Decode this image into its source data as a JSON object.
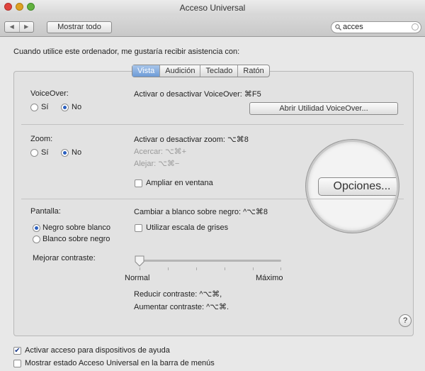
{
  "window": {
    "title": "Acceso Universal"
  },
  "toolbar": {
    "back_glyph": "◀",
    "forward_glyph": "▶",
    "show_all_label": "Mostrar todo",
    "search_value": "acces",
    "search_icon": "search-icon",
    "clear_icon": "clear-icon"
  },
  "main": {
    "intro": "Cuando utilice este ordenador, me gustaría recibir asistencia con:",
    "tabs": [
      {
        "label": "Vista",
        "selected": true
      },
      {
        "label": "Audición",
        "selected": false
      },
      {
        "label": "Teclado",
        "selected": false
      },
      {
        "label": "Ratón",
        "selected": false
      }
    ]
  },
  "voiceover": {
    "label": "VoiceOver:",
    "options": [
      {
        "label": "Sí",
        "selected": false
      },
      {
        "label": "No",
        "selected": true
      }
    ],
    "shortcut": "Activar o desactivar VoiceOver: ⌘F5",
    "open_utility_button": "Abrir Utilidad VoiceOver..."
  },
  "zoom": {
    "label": "Zoom:",
    "options": [
      {
        "label": "Sí",
        "selected": false
      },
      {
        "label": "No",
        "selected": true
      }
    ],
    "shortcut": "Activar o desactivar zoom: ⌥⌘8",
    "zoom_in": "Acercar: ⌥⌘+",
    "zoom_out": "Alejar: ⌥⌘−",
    "window_checkbox": {
      "label": "Ampliar en ventana",
      "checked": false
    },
    "options_button": "Opciones..."
  },
  "display": {
    "label": "Pantalla:",
    "options": [
      {
        "label": "Negro sobre blanco",
        "selected": true
      },
      {
        "label": "Blanco sobre negro",
        "selected": false
      }
    ],
    "invert_shortcut": "Cambiar a blanco sobre negro: ^⌥⌘8",
    "grayscale_checkbox": {
      "label": "Utilizar escala de grises",
      "checked": false
    },
    "contrast_label": "Mejorar contraste:",
    "contrast_value": 0,
    "contrast_min": "Normal",
    "contrast_max": "Máximo",
    "reduce_contrast": "Reducir contraste: ^⌥⌘,",
    "increase_contrast": "Aumentar contraste: ^⌥⌘.",
    "help_label": "?"
  },
  "footer": {
    "assistive_devices": {
      "label": "Activar acceso para dispositivos de ayuda",
      "checked": true
    },
    "menubar_status": {
      "label": "Mostrar estado Acceso Universal en la barra de menús",
      "checked": false
    }
  },
  "colors": {
    "accent": "#2a5fbf",
    "close": "#e0443e",
    "minimize": "#dea123",
    "zoom": "#62b13f"
  }
}
